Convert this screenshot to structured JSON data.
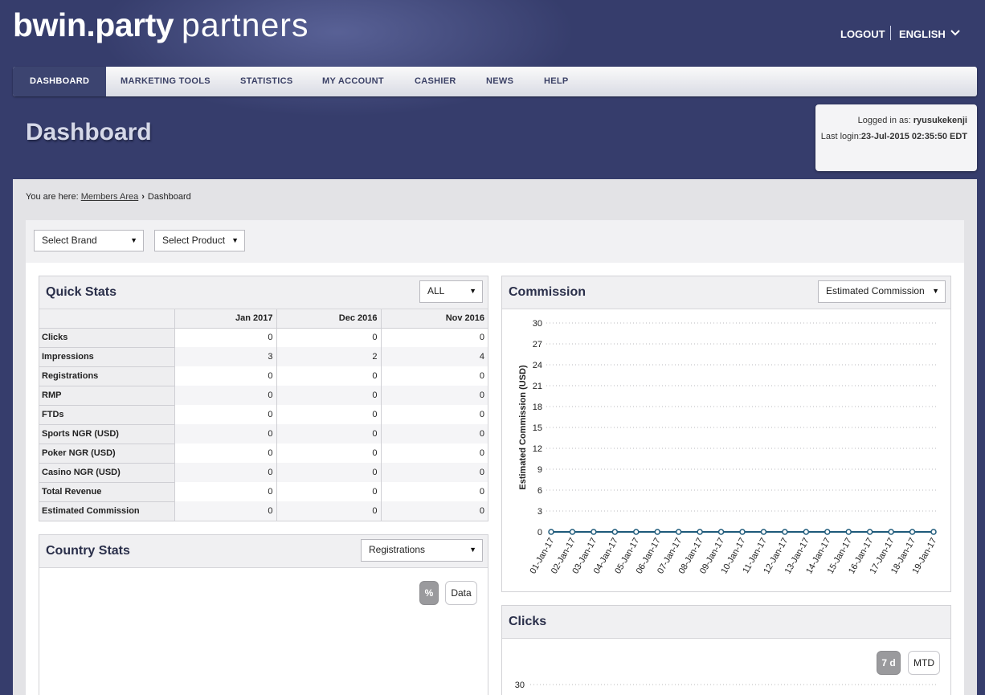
{
  "brand": {
    "name_bold": "bwin.party",
    "name_light": "partners"
  },
  "header": {
    "logout": "LOGOUT",
    "language": "ENGLISH"
  },
  "nav": {
    "items": [
      {
        "label": "DASHBOARD"
      },
      {
        "label": "MARKETING TOOLS"
      },
      {
        "label": "STATISTICS"
      },
      {
        "label": "MY ACCOUNT"
      },
      {
        "label": "CASHIER"
      },
      {
        "label": "NEWS"
      },
      {
        "label": "HELP"
      }
    ]
  },
  "page": {
    "title": "Dashboard"
  },
  "login": {
    "logged_in_label": "Logged in as: ",
    "username": "ryusukekenji",
    "last_login_label": "Last login:",
    "last_login_value": "23-Jul-2015 02:35:50 EDT"
  },
  "breadcrumb": {
    "prefix": "You are here:",
    "link": "Members Area",
    "current": "Dashboard"
  },
  "filters": {
    "brand": "Select Brand",
    "product": "Select Product"
  },
  "quick_stats": {
    "title": "Quick Stats",
    "filter": "ALL",
    "columns": [
      "Jan 2017",
      "Dec 2016",
      "Nov 2016"
    ],
    "rows": [
      {
        "label": "Clicks",
        "values": [
          "0",
          "0",
          "0"
        ]
      },
      {
        "label": "Impressions",
        "values": [
          "3",
          "2",
          "4"
        ]
      },
      {
        "label": "Registrations",
        "values": [
          "0",
          "0",
          "0"
        ]
      },
      {
        "label": "RMP",
        "values": [
          "0",
          "0",
          "0"
        ]
      },
      {
        "label": "FTDs",
        "values": [
          "0",
          "0",
          "0"
        ]
      },
      {
        "label": "Sports NGR (USD)",
        "values": [
          "0",
          "0",
          "0"
        ]
      },
      {
        "label": "Poker NGR (USD)",
        "values": [
          "0",
          "0",
          "0"
        ]
      },
      {
        "label": "Casino NGR (USD)",
        "values": [
          "0",
          "0",
          "0"
        ]
      },
      {
        "label": "Total Revenue",
        "values": [
          "0",
          "0",
          "0"
        ]
      },
      {
        "label": "Estimated Commission",
        "values": [
          "0",
          "0",
          "0"
        ]
      }
    ]
  },
  "country_stats": {
    "title": "Country Stats",
    "filter": "Registrations",
    "toggle_percent": "%",
    "toggle_data": "Data"
  },
  "commission": {
    "title": "Commission",
    "filter": "Estimated Commission"
  },
  "clicks": {
    "title": "Clicks",
    "toggle_7d": "7 d",
    "toggle_mtd": "MTD",
    "ytick_top": "30"
  },
  "colors": {
    "line": "#1e5a7a",
    "nav_active": "#3c4470",
    "background": "#363d6c"
  },
  "chart_data": {
    "type": "line",
    "title": "",
    "ylabel": "Estimated Commission (USD)",
    "xlabel": "",
    "ylim": [
      0,
      30
    ],
    "yticks": [
      0,
      3,
      6,
      9,
      12,
      15,
      18,
      21,
      24,
      27,
      30
    ],
    "grid": true,
    "categories": [
      "01-Jan-17",
      "02-Jan-17",
      "03-Jan-17",
      "04-Jan-17",
      "05-Jan-17",
      "06-Jan-17",
      "07-Jan-17",
      "08-Jan-17",
      "09-Jan-17",
      "10-Jan-17",
      "11-Jan-17",
      "12-Jan-17",
      "13-Jan-17",
      "14-Jan-17",
      "15-Jan-17",
      "16-Jan-17",
      "17-Jan-17",
      "18-Jan-17",
      "19-Jan-17"
    ],
    "series": [
      {
        "values": [
          0,
          0,
          0,
          0,
          0,
          0,
          0,
          0,
          0,
          0,
          0,
          0,
          0,
          0,
          0,
          0,
          0,
          0,
          0
        ]
      }
    ]
  }
}
